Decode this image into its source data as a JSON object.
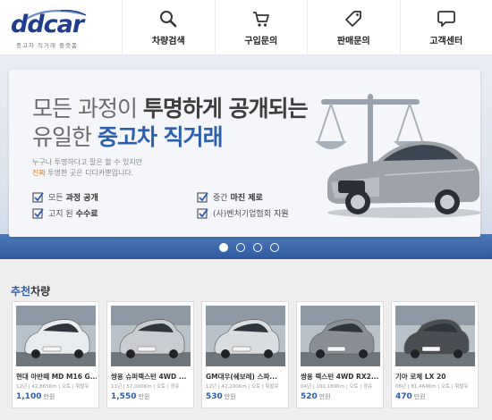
{
  "logo": {
    "wordmark": "ddcar",
    "tagline": "중고차 직거래 플랫폼"
  },
  "nav": [
    {
      "label": "차량검색",
      "icon": "search-icon"
    },
    {
      "label": "구입문의",
      "icon": "cart-icon"
    },
    {
      "label": "판매문의",
      "icon": "price-tag-icon"
    },
    {
      "label": "고객센터",
      "icon": "chat-bubble-icon"
    }
  ],
  "hero": {
    "title_line1_a": "모든 과정이 ",
    "title_line1_b": "투명하게 공개되는",
    "title_line2_a": "유일한 ",
    "title_line2_b": "중고차 직거래",
    "desc_line1": "누구나 투명하다고 말은 할 수 있지만",
    "desc_line2_hl": "진짜",
    "desc_line2": " 투명한 곳은 디디카뿐입니다.",
    "features": [
      {
        "light": "모든",
        "strong": "과정 공개"
      },
      {
        "light": "고지 된",
        "strong": "수수료"
      },
      {
        "light": "중간",
        "strong": "마진 제로"
      },
      {
        "light": "(사)벤처기업협회",
        "strong": "지원"
      }
    ],
    "slides": 4,
    "active_slide": 1,
    "colors": {
      "accent": "#2c5fae",
      "highlight": "#e07b1e",
      "band": "#2f5a9f"
    }
  },
  "recommended": {
    "title_accent": "추천",
    "title_rest": "차량",
    "cars": [
      {
        "name": "현대 아반떼 MD M16 G...",
        "meta": "12년 | 42,865Km | 오토 | 휘발유",
        "price": "1,100",
        "unit": "만원",
        "color": "#e8ecef"
      },
      {
        "name": "쌍용 슈퍼렉스턴 4WD ...",
        "meta": "11년 | 57,000Km | 오토 | 경유",
        "price": "1,550",
        "unit": "만원",
        "color": "#c9ccd0"
      },
      {
        "name": "GM대우(쉐보레) 스파...",
        "meta": "12년 | 42,200Km | 오토 | 휘발유",
        "price": "530",
        "unit": "만원",
        "color": "#d9dde0"
      },
      {
        "name": "쌍용 렉스턴 4WD RX2...",
        "meta": "04년 | 100,189Km | 오토 | 경유",
        "price": "520",
        "unit": "만원",
        "color": "#8a8f96"
      },
      {
        "name": "기아 로체 LX 20",
        "meta": "06년 | 81,464Km | 오토 | 휘발유",
        "price": "470",
        "unit": "만원",
        "color": "#4a4d52"
      }
    ]
  }
}
